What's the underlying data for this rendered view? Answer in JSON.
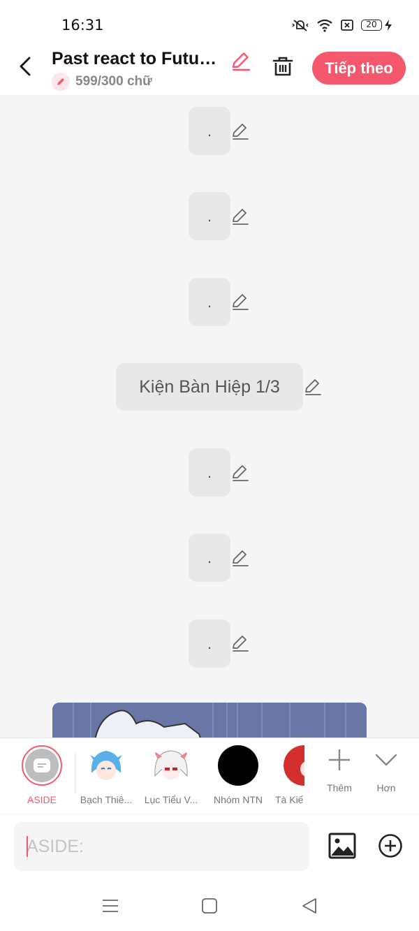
{
  "status": {
    "time": "16:31",
    "battery": "20"
  },
  "header": {
    "title": "Past react to Futur...",
    "word_count": "599/300 chữ",
    "next_label": "Tiếp theo"
  },
  "messages": [
    {
      "text": "."
    },
    {
      "text": "."
    },
    {
      "text": "."
    },
    {
      "text": "Kiện Bàn Hiệp 1/3"
    },
    {
      "text": "."
    },
    {
      "text": "."
    },
    {
      "text": "."
    }
  ],
  "characters": {
    "items": [
      {
        "label": "ASIDE"
      },
      {
        "label": "Bạch Thiê..."
      },
      {
        "label": "Lục Tiểu V..."
      },
      {
        "label": "Nhóm NTN"
      },
      {
        "label": "Tà Kiế"
      }
    ],
    "add_label": "Thêm",
    "more_label": "Hơn"
  },
  "composer": {
    "placeholder": "ASIDE:"
  },
  "colors": {
    "accent": "#f5576c",
    "background": "#f5f5f5",
    "bubble": "#e8e8e8"
  }
}
